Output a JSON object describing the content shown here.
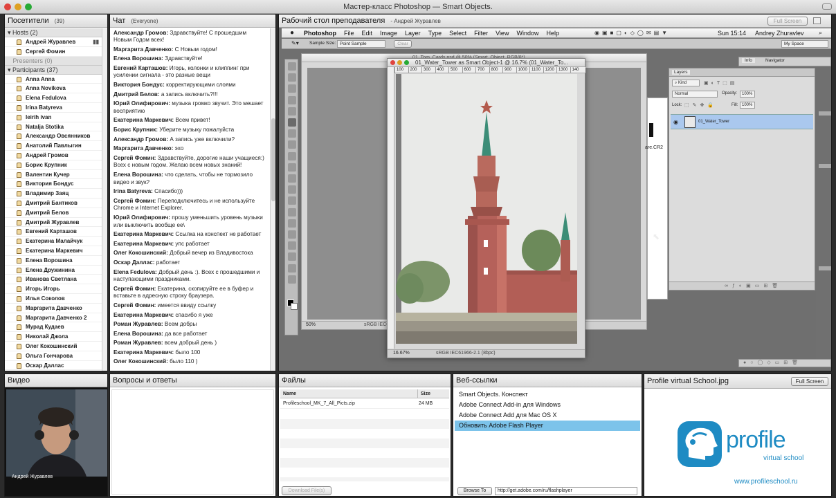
{
  "window": {
    "title": "Мастер-класс Photoshop — Smart Objects."
  },
  "attendees": {
    "title": "Посетители",
    "count": "(39)",
    "hosts_label": "Hosts (2)",
    "hosts": [
      "Андрей Журавлев",
      "Сергей Фомин"
    ],
    "presenters_label": "Presenters (0)",
    "participants_label": "Participants (37)",
    "participants": [
      "Anna Anna",
      "Anna Novikova",
      "Elena Fedulova",
      "Irina Batyreva",
      "Ieirih ivan",
      "Natalja Stotika",
      "Александр Овсянников",
      "Анатолий Павлыгин",
      "Андрей Громов",
      "Борис Крупник",
      "Валентин Кучер",
      "Виктория Бондус",
      "Владимир Заяц",
      "Дмитрий Бантиков",
      "Дмитрий Белов",
      "Дмитрий Журавлев",
      "Евгений Карташов",
      "Екатерина Малайчук",
      "Екатерина Маркевич",
      "Елена Ворошина",
      "Елена Дружинина",
      "Иванова Светлана",
      "Игорь Игорь",
      "Илья Соколов",
      "Маргарита Давченко",
      "Маргарита Давченко 2",
      "Мурад Кудаев",
      "Николай Джола",
      "Олег Кокошинский",
      "Ольга Гончарова",
      "Оскар Даллас"
    ]
  },
  "chat": {
    "title": "Чат",
    "scope": "(Everyone)",
    "messages": [
      {
        "name": "Александр Громов:",
        "text": "Здравствуйте! С прошедшим Новым Годом всех!"
      },
      {
        "name": "Маргарита Давченко:",
        "text": "С Новым годом!"
      },
      {
        "name": "Елена Ворошина:",
        "text": "Здравствуйте!"
      },
      {
        "name": "Евгений Карташов:",
        "text": "Игорь, колонки и клиппинг при усилении сигнала - это разные вещи"
      },
      {
        "name": "Виктория Бондус:",
        "text": "корректирующими слоями"
      },
      {
        "name": "Дмитрий Белов:",
        "text": "а запись включить?!!!"
      },
      {
        "name": "Юрий Олифирович:",
        "text": "музыка громко звучит. Это мешает восприятию"
      },
      {
        "name": "Екатерина Маркевич:",
        "text": "Всем привет!"
      },
      {
        "name": "Борис Крупник:",
        "text": "Уберите музыку пожалуйста"
      },
      {
        "name": "Александр Громов:",
        "text": "А запись уже включили?"
      },
      {
        "name": "Маргарита Давченко:",
        "text": "эхо"
      },
      {
        "name": "Сергей Фомин:",
        "text": "Здравствуйте, дорогие наши учащиеся:) Всех с новым годом. Желаю всем новых знаний!"
      },
      {
        "name": "Елена Ворошина:",
        "text": "что сделать, чтобы не тормозило видео и звук?"
      },
      {
        "name": "Irina Batyreva:",
        "text": "Спасибо)))"
      },
      {
        "name": "Сергей Фомин:",
        "text": "Переподключитесь и не используйте Chrome и Internet Explorer."
      },
      {
        "name": "Юрий Олифирович:",
        "text": "прошу уменьшить уровень музыки или выключить вообще ее\\"
      },
      {
        "name": "Екатерина Маркевич:",
        "text": "Ссылка на конспект не работает"
      },
      {
        "name": "Екатерина Маркевич:",
        "text": "упс работает"
      },
      {
        "name": "Олег Кокошинский:",
        "text": "Добрый вечер из Владивостока"
      },
      {
        "name": "Оскар Даллас:",
        "text": "работает"
      },
      {
        "name": "Elena Fedulova:",
        "text": "Добрый день :). Всех с прошедшими и наступающими праздниками."
      },
      {
        "name": "Сергей Фомин:",
        "text": "Екатерина, скопируйте ее в буфер и вставьте в адресную строку браузера."
      },
      {
        "name": "Сергей Фомин:",
        "text": "имеется ввиду ссылку"
      },
      {
        "name": "Екатерина Маркевич:",
        "text": "спасибо я уже"
      },
      {
        "name": "Роман Журавлев:",
        "text": "Всем добры"
      },
      {
        "name": "Елена Ворошина:",
        "text": "да все работает"
      },
      {
        "name": "Роман Журавлев:",
        "text": "всем добрый день )"
      },
      {
        "name": "Екатерина Маркевич:",
        "text": "было 100"
      },
      {
        "name": "Олег Кокошинский:",
        "text": "было 110 )"
      }
    ]
  },
  "desktop": {
    "title": "Рабочий стол преподавателя",
    "owner": "- Андрей Журавлев",
    "fullscreen": "Full Screen",
    "ps_menu": [
      "Photoshop",
      "File",
      "Edit",
      "Image",
      "Layer",
      "Type",
      "Select",
      "Filter",
      "View",
      "Window",
      "Help"
    ],
    "clock": "Sun 15:14",
    "user": "Andrey Zhuravlev",
    "sample_label": "Sample Size:",
    "sample_value": "Point Sample",
    "clear": "Clear",
    "workspace": "My Space",
    "doc_back_title": "01_Tom_Cards.psd @ 50% (Smart_Object, RGB/8*)",
    "doc_title": "01_Water_Tower as Smart Object-1 @ 16.7% (01_Water_To...",
    "ruler": [
      "100",
      "200",
      "300",
      "400",
      "500",
      "600",
      "700",
      "800",
      "900",
      "1000",
      "1100",
      "1200",
      "1300",
      "140"
    ],
    "zoom_front": "16.67%",
    "profile_front": "sRGB IEC61966-2.1 (8bpc)",
    "zoom_back": "50%",
    "profile_back": "sRGB IEC61966-2.1 (8",
    "cr2_label": "are.CR2",
    "info_tab": "Info",
    "nav_tab": "Navigator",
    "layers_title": "Layers",
    "kind": "Kind",
    "blend": "Normal",
    "opacity_label": "Opacity:",
    "opacity": "100%",
    "lock_label": "Lock:",
    "fill_label": "Fill:",
    "fill": "100%",
    "layer_name": "01_Water_Tower"
  },
  "video": {
    "title": "Видео",
    "name": "Андрей Журавлев"
  },
  "qa": {
    "title": "Вопросы и ответы"
  },
  "files": {
    "title": "Файлы",
    "col_name": "Name",
    "col_size": "Size",
    "file_name": "Profileschool_MK_7_All_Picts.zip",
    "file_size": "24 MB",
    "download": "Download File(s)"
  },
  "weblinks": {
    "title": "Веб-ссылки",
    "items": [
      "Smart Objects. Конспект",
      "Adobe Connect Add-in для Windows",
      "Adobe Connect Add для Mac OS X",
      "Обновить Adobe Flash Player"
    ],
    "browse": "Browse To",
    "url": "http://get.adobe.com/ru/flashplayer"
  },
  "profile": {
    "title": "Profile virtual School.jpg",
    "fullscreen": "Full Screen",
    "brand": "profile",
    "tagline": "virtual school",
    "site": "www.profileschool.ru"
  },
  "colors": {
    "accent": "#1e8bc3",
    "selected": "#7cc3ea",
    "layer_sel": "#aac8ee"
  },
  "icons": [
    "user-icon",
    "mic-icon",
    "eye-icon",
    "chevron-down-icon",
    "apple-icon",
    "search-icon"
  ]
}
